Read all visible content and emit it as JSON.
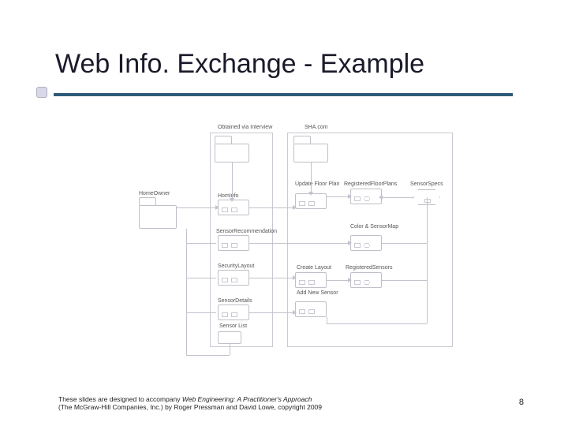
{
  "title": "Web Info. Exchange - Example",
  "page_number": "8",
  "footer": {
    "line1_a": "These slides are designed to accompany ",
    "line1_b": "Web Engineering: A Practitioner's Approach",
    "line2": "(The McGraw-Hill Companies, Inc.) by Roger Pressman and David Lowe, copyright 2009"
  },
  "diagram": {
    "obtained_label": "Obtained via Interview",
    "sha_label": "SHA.com",
    "homeowner": "HomeOwner",
    "hominfo": "HomInfo",
    "sensor_reco": "SensorRecommendation",
    "security_layout": "SecurityLayout",
    "sensor_details": "SensorDetails",
    "sensor_list": "Sensor List",
    "update_floor_plan": "Update Floor Plan",
    "create_layout": "Create Layout",
    "add_new_sensor": "Add New Sensor",
    "registered_floor_plans": "RegisteredFloorPlans",
    "color_and_sensor_map": "Color & SensorMap",
    "registered_sensors": "RegisteredSensors",
    "sensor_specs": "SensorSpecs"
  }
}
